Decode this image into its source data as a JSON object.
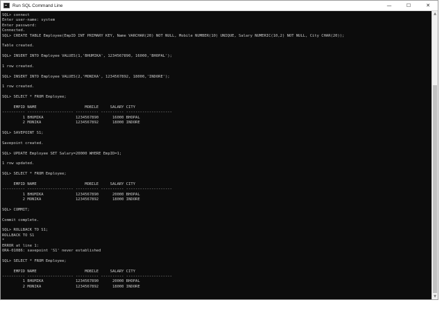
{
  "window": {
    "title": "Run SQL Command Line",
    "icon": "terminal-icon",
    "controls": {
      "minimize": "—",
      "maximize": "☐",
      "close": "✕"
    }
  },
  "console": {
    "lines": [
      "SQL> connect",
      "Enter user-name: system",
      "Enter password:",
      "Connected.",
      "SQL> CREATE TABLE Employee(EmpID INT PRIMARY KEY, Name VARCHAR(20) NOT NULL, Mobile NUMBER(10) UNIQUE, Salary NUMERIC(10,2) NOT NULL, City CHAR(20));",
      "",
      "Table created.",
      "",
      "SQL> INSERT INTO Employee VALUES(1,'BHUMIKA', 1234567890, 16000,'BHOPAL');",
      "",
      "1 row created.",
      "",
      "SQL> INSERT INTO Employee VALUES(2,'MONIKA', 1234567892, 18000,'INDORE');",
      "",
      "1 row created.",
      "",
      "SQL> SELECT * FROM Employee;",
      "",
      "     EMPID NAME                     MOBILE     SALARY CITY",
      "---------- -------------------- ---------- ---------- --------------------",
      "         1 BHUMIKA              1234567890      16000 BHOPAL",
      "         2 MONIKA               1234567892      18000 INDORE",
      "",
      "SQL> SAVEPOINT S1;",
      "",
      "Savepoint created.",
      "",
      "SQL> UPDATE Employee SET Salary=20000 WHERE EmpID=1;",
      "",
      "1 row updated.",
      "",
      "SQL> SELECT * FROM Employee;",
      "",
      "     EMPID NAME                     MOBILE     SALARY CITY",
      "---------- -------------------- ---------- ---------- --------------------",
      "         1 BHUMIKA              1234567890      20000 BHOPAL",
      "         2 MONIKA               1234567892      18000 INDORE",
      "",
      "SQL> COMMIT;",
      "",
      "Commit complete.",
      "",
      "SQL> ROLLBACK TO S1;",
      "ROLLBACK TO S1",
      "*",
      "ERROR at line 1:",
      "ORA-01086: savepoint 'S1' never established",
      "",
      "SQL> SELECT * FROM Employee;",
      "",
      "     EMPID NAME                     MOBILE     SALARY CITY",
      "---------- -------------------- ---------- ---------- --------------------",
      "         1 BHUMIKA              1234567890      20000 BHOPAL",
      "         2 MONIKA               1234567892      18000 INDORE"
    ]
  },
  "scrollbar": {
    "up_arrow": "▲",
    "down_arrow": "▼"
  }
}
